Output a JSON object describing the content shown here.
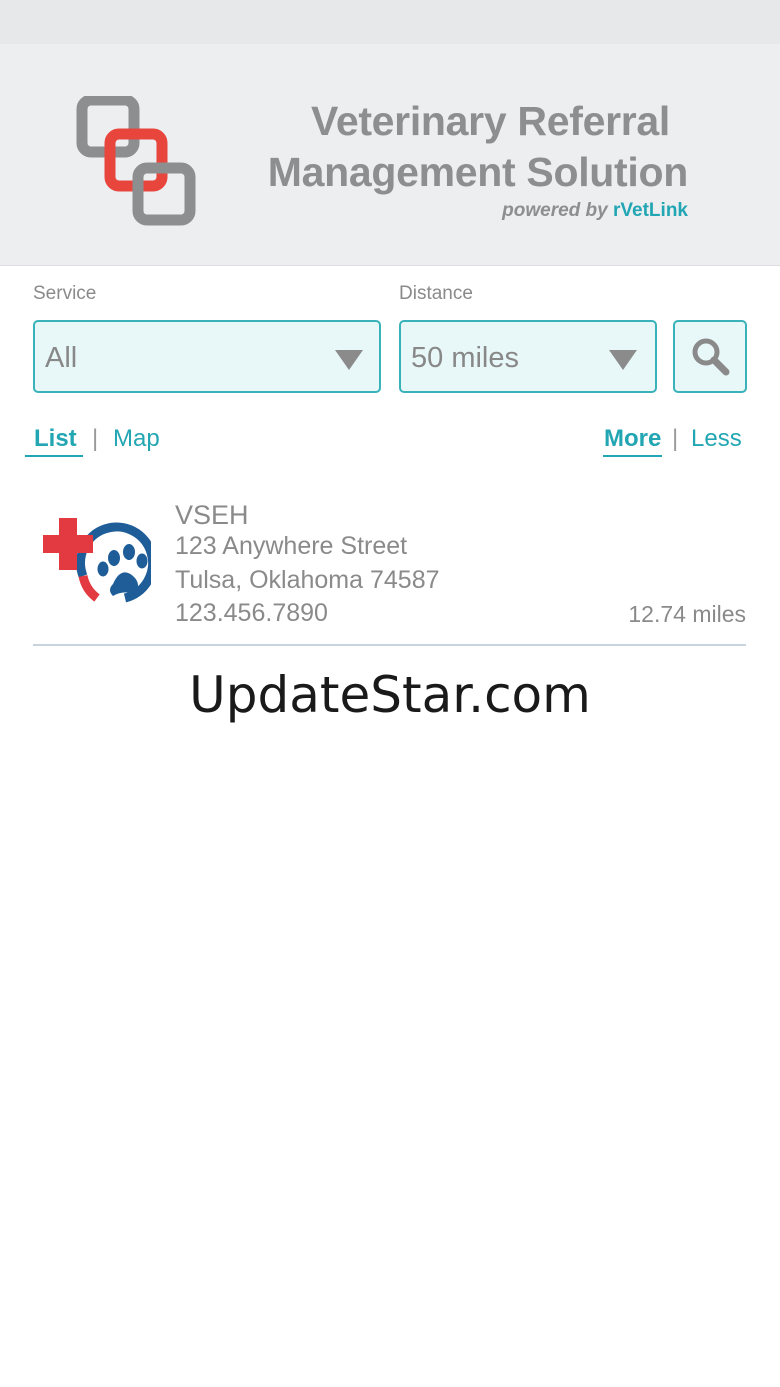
{
  "header": {
    "title_line1": "Veterinary Referral",
    "title_line2": "Management Solution",
    "powered_prefix": "powered by",
    "powered_brand": "rVetLink",
    "brand_color": "#22a6b3",
    "logo_accent": "#e8453c"
  },
  "filters": {
    "service_label": "Service",
    "service_value": "All",
    "distance_label": "Distance",
    "distance_value": "50 miles",
    "search_icon": "search-icon"
  },
  "view_toggle": {
    "list_label": "List",
    "map_label": "Map",
    "separator": "|",
    "active": "List"
  },
  "detail_toggle": {
    "more_label": "More",
    "less_label": "Less",
    "separator": "|",
    "active": "More"
  },
  "results": [
    {
      "name": "VSEH",
      "street": "123 Anywhere Street",
      "city": "Tulsa, Oklahoma 74587",
      "phone": "123.456.7890",
      "distance": "12.74 miles"
    }
  ],
  "watermark": "UpdateStar.com"
}
